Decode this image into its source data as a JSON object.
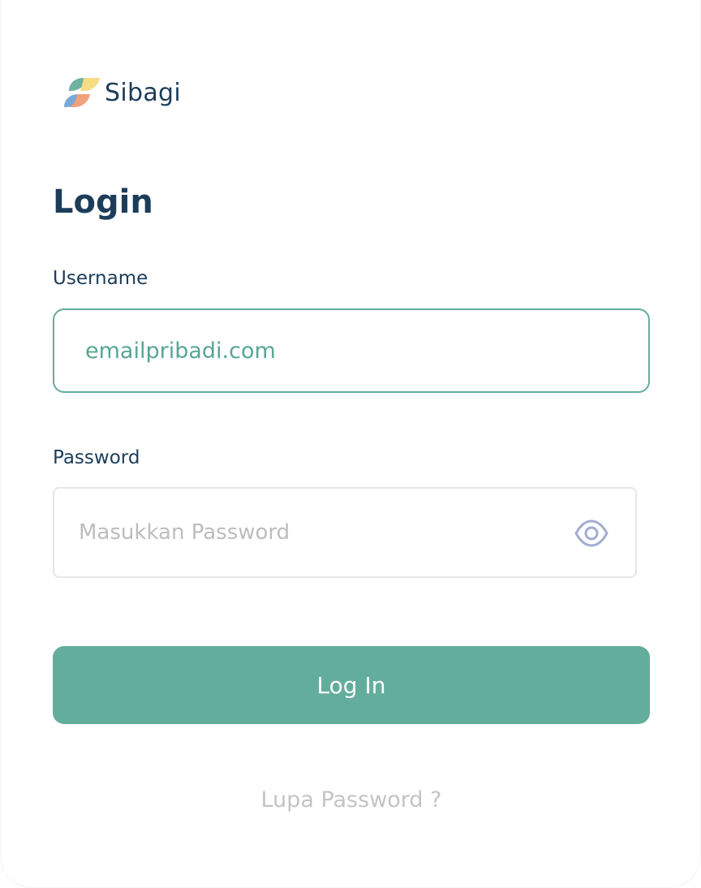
{
  "brand": {
    "name": "Sibagi",
    "logo_icon": "sibagi-logo",
    "colors": [
      "#6fb29f",
      "#f6dc84",
      "#7aa8d9",
      "#f2a07b"
    ]
  },
  "page": {
    "title": "Login"
  },
  "username": {
    "label": "Username",
    "value": "emailpribadi.com",
    "accent_color": "#63ad9d"
  },
  "password": {
    "label": "Password",
    "value": "",
    "placeholder": "Masukkan Password",
    "toggle_icon": "eye-icon"
  },
  "actions": {
    "login_label": "Log In",
    "login_color": "#63ad9d",
    "forgot_label": "Lupa Password ?"
  }
}
